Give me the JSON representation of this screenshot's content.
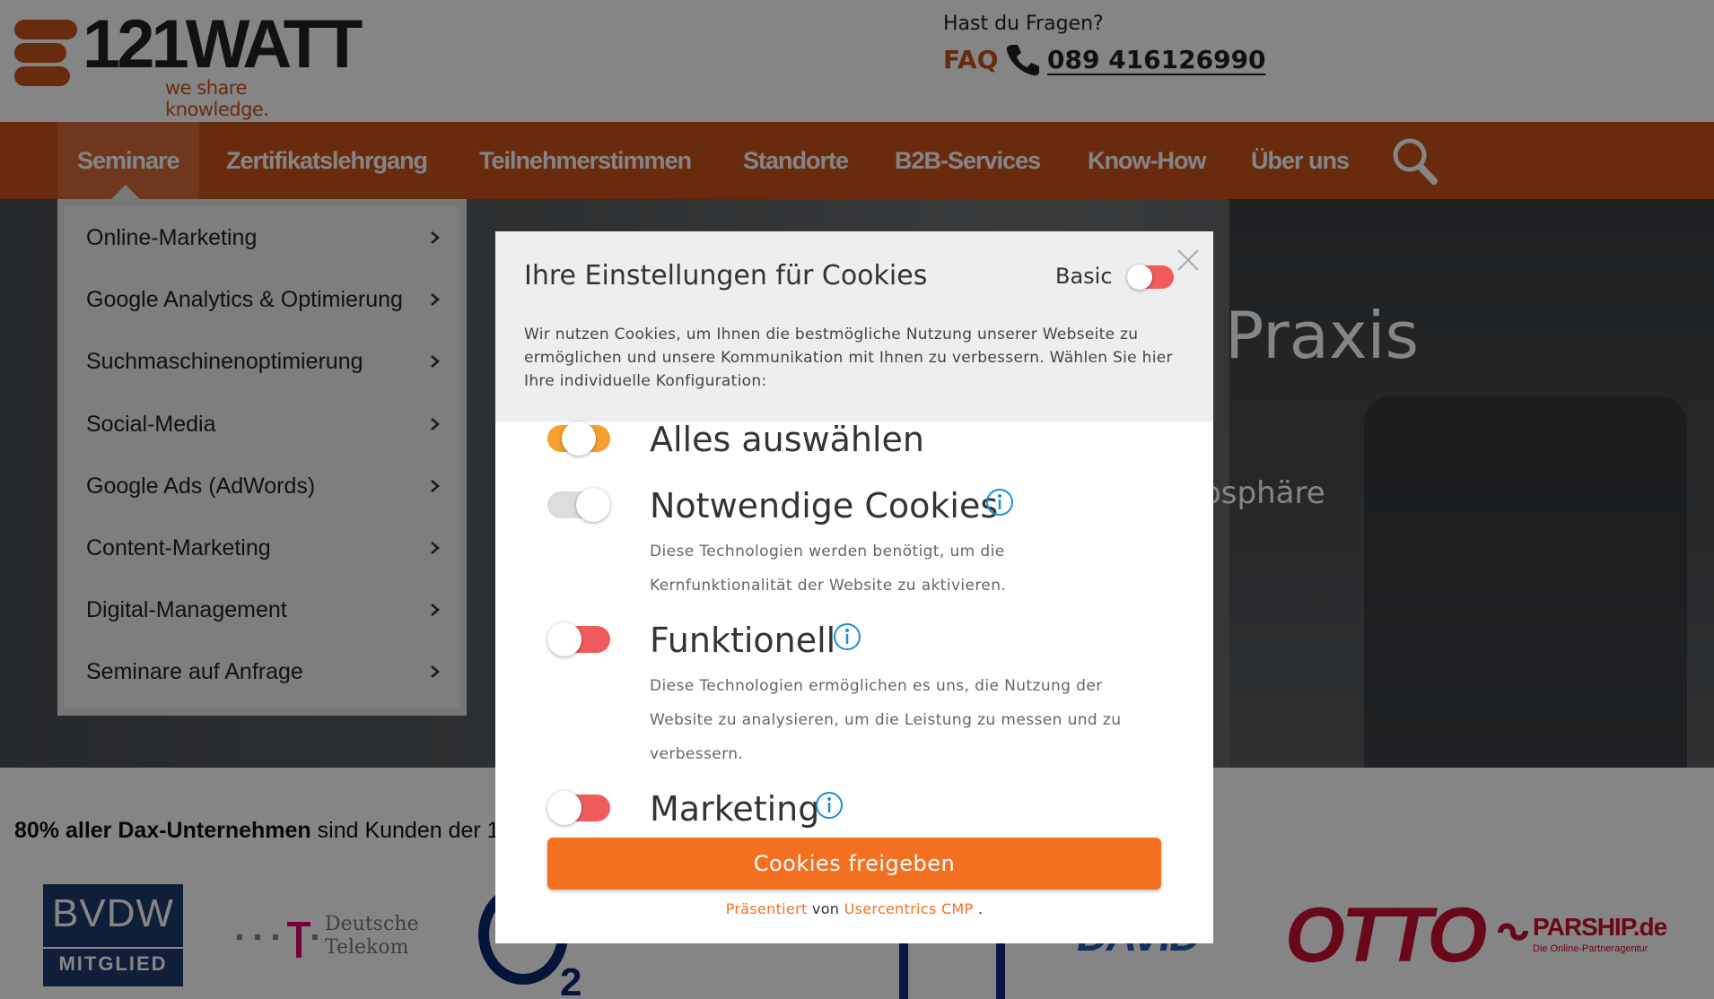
{
  "header": {
    "logo": {
      "word": "121WATT",
      "tagline": "we share knowledge."
    },
    "help_question": "Hast du Fragen?",
    "faq_label": "FAQ",
    "phone_icon": "phone-icon",
    "phone_number": "089 416126990"
  },
  "nav": {
    "items": [
      {
        "label": "Seminare",
        "active": true
      },
      {
        "label": "Zertifikatslehrgang"
      },
      {
        "label": "Teilnehmerstimmen"
      },
      {
        "label": "Standorte"
      },
      {
        "label": "B2B-Services"
      },
      {
        "label": "Know-How"
      },
      {
        "label": "Über uns"
      }
    ],
    "search_icon": "search-icon"
  },
  "dropdown": {
    "items": [
      "Online-Marketing",
      "Google Analytics & Optimierung",
      "Suchmaschinenoptimierung",
      "Social-Media",
      "Google Ads (AdWords)",
      "Content-Marketing",
      "Digital-Management",
      "Seminare auf Anfrage"
    ]
  },
  "hero": {
    "title_fragment": "Praxis",
    "subtitle_fragment": "osphäre"
  },
  "customers": {
    "bold": "80% aller Dax-Unternehmen",
    "rest": " sind Kunden der 1",
    "logos": {
      "bvdw_top": "BVDW",
      "bvdw_bottom": "MITGLIED",
      "telekom": "Deutsche\nTelekom",
      "maid": "DAVID",
      "otto": "OTTO",
      "parship": "PARSHIP.de",
      "parship_sub": "Die Online-Partneragentur"
    }
  },
  "cookie_modal": {
    "title": "Ihre Einstellungen für Cookies",
    "basic_label": "Basic",
    "description": "Wir nutzen Cookies, um Ihnen die bestmögliche Nutzung unserer Webseite zu ermöglichen und unsere Kommunikation mit Ihnen zu verbessern. Wählen Sie hier Ihre individuelle Konfiguration:",
    "options": [
      {
        "title": "Alles auswählen",
        "state": "on",
        "color": "#f5a030"
      },
      {
        "title": "Notwendige Cookies",
        "state": "locked",
        "color": "#dcdcdc",
        "desc": "Diese Technologien werden benötigt, um die Kernfunktionalität der Website zu aktivieren."
      },
      {
        "title": "Funktionell",
        "state": "off",
        "color": "#f05c5c",
        "desc": "Diese Technologien ermöglichen es uns, die Nutzung der Website zu analysieren, um die Leistung zu messen und zu verbessern."
      },
      {
        "title": "Marketing",
        "state": "off",
        "color": "#f05c5c"
      }
    ],
    "cta_label": "Cookies freigeben",
    "powered": {
      "presented": "Präsentiert",
      "von": "von",
      "provider": "Usercentrics CMP",
      "dot": "."
    }
  },
  "colors": {
    "brand": "#c9531c",
    "cta": "#f37021",
    "info": "#1a8fd6",
    "toggle_off": "#f05c5c",
    "toggle_all": "#f5a030"
  }
}
